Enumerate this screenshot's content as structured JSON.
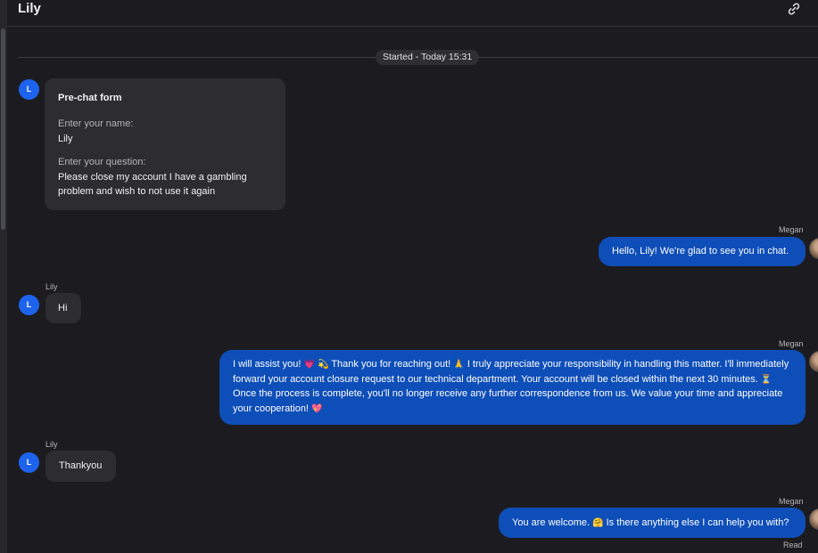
{
  "header": {
    "title": "Lily",
    "link_icon": "link-icon",
    "more_icon": "more-icon",
    "more_glyph": "⋮"
  },
  "divider": {
    "label": "Started - Today 15:31"
  },
  "visitor": {
    "name": "Lily",
    "initial": "L",
    "avatar_color": "#1d63ed"
  },
  "agent": {
    "name": "Megan"
  },
  "prechat_form": {
    "title": "Pre-chat form",
    "name_label": "Enter your name:",
    "name_value": "Lily",
    "question_label": "Enter your question:",
    "question_value": "Please close my account I have a gambling problem and wish to not use it again"
  },
  "messages": [
    {
      "from": "agent",
      "sender": "Megan",
      "text": "Hello, Lily! We're glad to see you in chat."
    },
    {
      "from": "visitor",
      "sender": "Lily",
      "text": "Hi"
    },
    {
      "from": "agent",
      "sender": "Megan",
      "parts": [
        "I will assist you!",
        "Thank you for reaching out!",
        "I truly appreciate your responsibility in handling this matter. I'll",
        "immediately forward your account closure request to our technical department. Your account will be closed within the next 30",
        "minutes.",
        "Once the process is complete, you'll no longer receive any further correspondence from us. We value your time",
        "and appreciate your cooperation!"
      ],
      "emojis": [
        "💗",
        "💫",
        "🙏",
        "⏳",
        "💖"
      ]
    },
    {
      "from": "visitor",
      "sender": "Lily",
      "text": "Thankyou"
    },
    {
      "from": "agent",
      "sender": "Megan",
      "parts": [
        "You are welcome.",
        "Is there anything else I can help you with?"
      ],
      "emojis": [
        "🤗"
      ],
      "status": "Read"
    }
  ],
  "colors": {
    "outgoing_bubble": "#0e4eb8",
    "incoming_bubble": "#2c2c31",
    "background": "#1c1c20"
  }
}
